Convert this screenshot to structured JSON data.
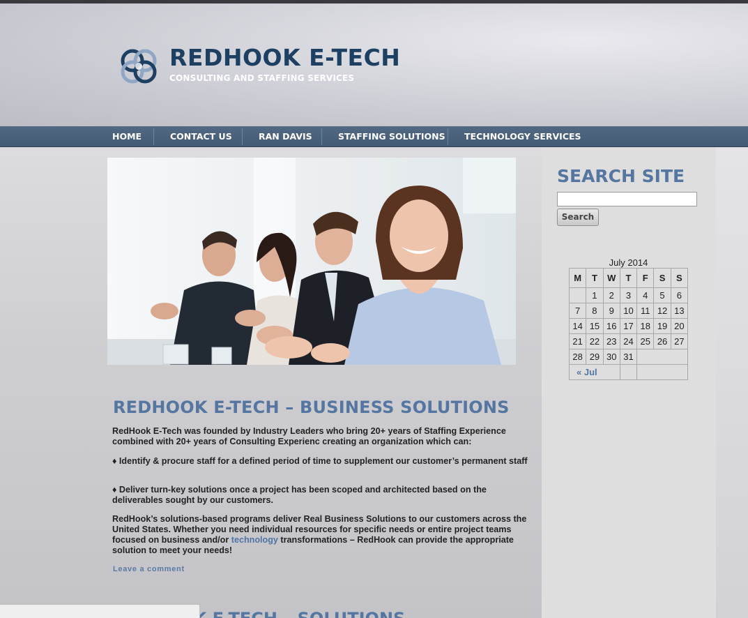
{
  "header": {
    "title": "REDHOOK E-TECH",
    "subtitle": "CONSULTING AND STAFFING SERVICES"
  },
  "nav": {
    "items": [
      {
        "label": "HOME"
      },
      {
        "label": "CONTACT US"
      },
      {
        "label": "RAN DAVIS"
      },
      {
        "label": "STAFFING SOLUTIONS"
      },
      {
        "label": "TECHNOLOGY SERVICES"
      }
    ]
  },
  "post": {
    "title": "REDHOOK E-TECH – BUSINESS SOLUTIONS",
    "intro": "RedHook E-Tech was founded by Industry Leaders who bring 20+ years of Staffing Experience combined with  20+ years of Consulting Experienc creating an organization which can:",
    "bullet1": "♦  Identify & procure staff for a defined period of time to supplement our customer’s permanent staff",
    "bullet2": "♦  Deliver turn-key solutions once a project has been scoped and architected based on the deliverables sought by our customers.",
    "closing_before": "RedHook’s solutions-based  programs deliver Real Business Solutions to our customers across the United States.  Whether you need individual resources for specific needs or entire project teams focused on business and/or ",
    "closing_link": "technology",
    "closing_after": " transformations – RedHook can provide the appropriate solution to meet your needs!",
    "leave_comment": "Leave a comment",
    "next_title_fragment": "REDHOOK E-TECH – SOLUTIONS"
  },
  "sidebar": {
    "search_title": "SEARCH SITE",
    "search_value": "",
    "search_button": "Search",
    "calendar": {
      "caption": "July 2014",
      "headers": [
        "M",
        "T",
        "W",
        "T",
        "F",
        "S",
        "S"
      ],
      "weeks": [
        [
          "",
          "1",
          "2",
          "3",
          "4",
          "5",
          "6"
        ],
        [
          "7",
          "8",
          "9",
          "10",
          "11",
          "12",
          "13"
        ],
        [
          "14",
          "15",
          "16",
          "17",
          "18",
          "19",
          "20"
        ],
        [
          "21",
          "22",
          "23",
          "24",
          "25",
          "26",
          "27"
        ],
        [
          "28",
          "29",
          "30",
          "31",
          "",
          "",
          ""
        ]
      ],
      "prev_label": "« Jul"
    }
  },
  "colors": {
    "brand_navy": "#1d3f62",
    "heading_blue": "#5476a1",
    "nav_bg": "#4a607b"
  }
}
